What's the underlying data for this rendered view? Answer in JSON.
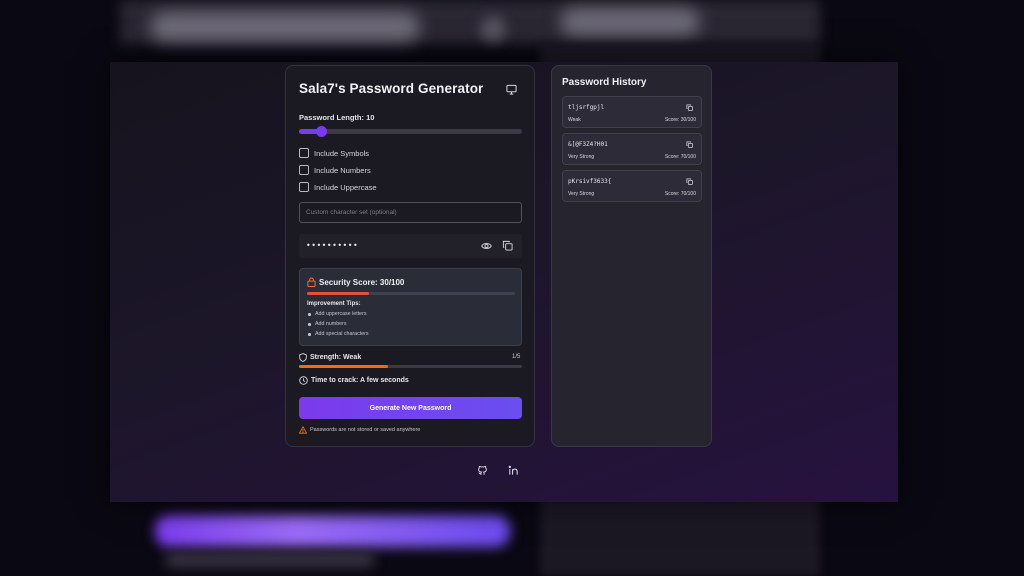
{
  "app": {
    "title": "Sala7's Password Generator",
    "display_icon": "monitor-icon"
  },
  "length": {
    "label": "Password Length: 10",
    "value": 10,
    "min": 4,
    "max": 64
  },
  "options": [
    {
      "label": "Include Symbols",
      "checked": false
    },
    {
      "label": "Include Numbers",
      "checked": false
    },
    {
      "label": "Include Uppercase",
      "checked": false
    }
  ],
  "custom_set": {
    "placeholder": "Custom character set (optional)",
    "value": ""
  },
  "password": {
    "masked": "••••••••••",
    "icons": [
      "eye-icon",
      "copy-icon"
    ]
  },
  "security": {
    "title": "Security Score: 30/100",
    "score": 30,
    "max": 100,
    "tips_title": "Improvement Tips:",
    "tips": [
      "Add uppercase letters",
      "Add numbers",
      "Add special characters"
    ]
  },
  "strength": {
    "label": "Strength: Weak",
    "count": "1/5",
    "fraction": 0.4
  },
  "crack": {
    "label": "Time to crack: A few seconds"
  },
  "actions": {
    "generate_label": "Generate New Password"
  },
  "notice": "Passwords are not stored or saved anywhere",
  "history": {
    "title": "Password History",
    "items": [
      {
        "password": "tljsrfgpjl",
        "strength": "Weak",
        "score": "Score: 30/100"
      },
      {
        "password": "&[@F3Z4?H01",
        "strength": "Very Strong",
        "score": "Score: 70/100"
      },
      {
        "password": "pKrsivf3633{",
        "strength": "Very Strong",
        "score": "Score: 70/100"
      }
    ]
  },
  "footer_icons": [
    "github-icon",
    "linkedin-icon"
  ],
  "colors": {
    "accent": "#7c3aed",
    "score_bar": "#e0523c",
    "strength_bar": "#f26b1d",
    "warning": "#f97316"
  }
}
